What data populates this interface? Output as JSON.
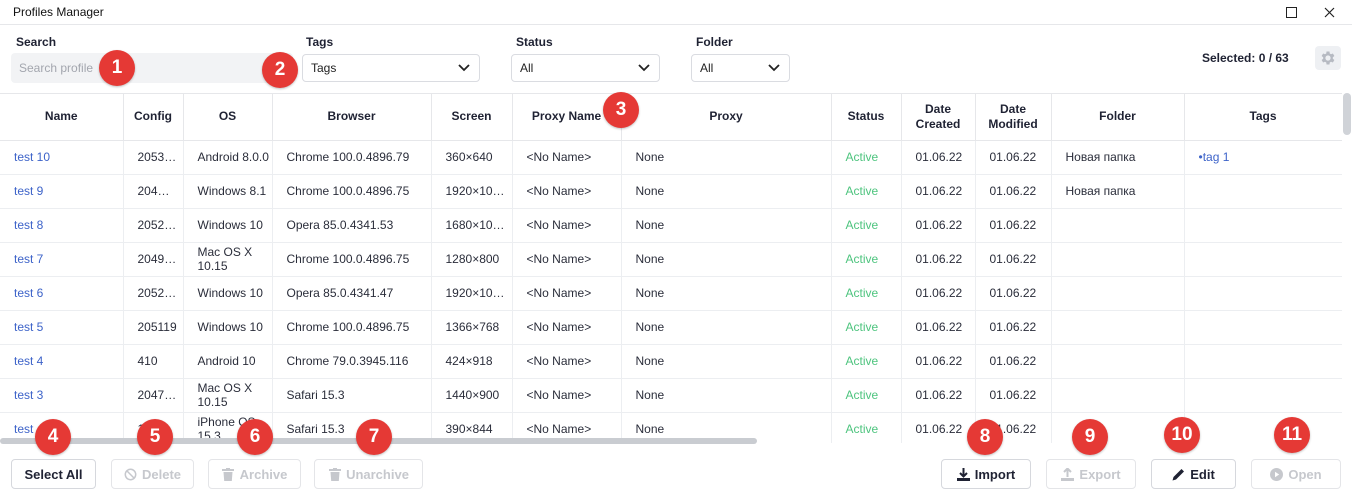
{
  "window": {
    "title": "Profiles Manager"
  },
  "filters": {
    "search_label": "Search",
    "search_placeholder": "Search profile",
    "tags_label": "Tags",
    "tags_value": "Tags",
    "status_label": "Status",
    "status_value": "All",
    "folder_label": "Folder",
    "folder_value": "All"
  },
  "selected_text": "Selected: 0 / 63",
  "columns": [
    "Name",
    "Config",
    "OS",
    "Browser",
    "Screen",
    "Proxy Name",
    "Proxy",
    "Status",
    "Date Created",
    "Date Modified",
    "Folder",
    "Tags"
  ],
  "rows": [
    {
      "name": "test 10",
      "config": "2053…",
      "os": "Android 8.0.0",
      "browser": "Chrome 100.0.4896.79",
      "screen": "360×640",
      "proxy_name": "<No Name>",
      "proxy": "None",
      "status": "Active",
      "created": "01.06.22",
      "modified": "01.06.22",
      "folder": "Новая папка",
      "tags": "•tag 1"
    },
    {
      "name": "test 9",
      "config": "204…",
      "os": "Windows 8.1",
      "browser": "Chrome 100.0.4896.75",
      "screen": "1920×10…",
      "proxy_name": "<No Name>",
      "proxy": "None",
      "status": "Active",
      "created": "01.06.22",
      "modified": "01.06.22",
      "folder": "Новая папка",
      "tags": ""
    },
    {
      "name": "test 8",
      "config": "2052…",
      "os": "Windows 10",
      "browser": "Opera 85.0.4341.53",
      "screen": "1680×10…",
      "proxy_name": "<No Name>",
      "proxy": "None",
      "status": "Active",
      "created": "01.06.22",
      "modified": "01.06.22",
      "folder": "",
      "tags": ""
    },
    {
      "name": "test 7",
      "config": "2049…",
      "os": "Mac OS X 10.15",
      "browser": "Chrome 100.0.4896.75",
      "screen": "1280×800",
      "proxy_name": "<No Name>",
      "proxy": "None",
      "status": "Active",
      "created": "01.06.22",
      "modified": "01.06.22",
      "folder": "",
      "tags": ""
    },
    {
      "name": "test 6",
      "config": "2052…",
      "os": "Windows 10",
      "browser": "Opera 85.0.4341.47",
      "screen": "1920×10…",
      "proxy_name": "<No Name>",
      "proxy": "None",
      "status": "Active",
      "created": "01.06.22",
      "modified": "01.06.22",
      "folder": "",
      "tags": ""
    },
    {
      "name": "test 5",
      "config": "205119",
      "os": "Windows 10",
      "browser": "Chrome 100.0.4896.75",
      "screen": "1366×768",
      "proxy_name": "<No Name>",
      "proxy": "None",
      "status": "Active",
      "created": "01.06.22",
      "modified": "01.06.22",
      "folder": "",
      "tags": ""
    },
    {
      "name": "test 4",
      "config": "410",
      "os": "Android 10",
      "browser": "Chrome 79.0.3945.116",
      "screen": "424×918",
      "proxy_name": "<No Name>",
      "proxy": "None",
      "status": "Active",
      "created": "01.06.22",
      "modified": "01.06.22",
      "folder": "",
      "tags": ""
    },
    {
      "name": "test 3",
      "config": "2047…",
      "os": "Mac OS X 10.15",
      "browser": "Safari 15.3",
      "screen": "1440×900",
      "proxy_name": "<No Name>",
      "proxy": "None",
      "status": "Active",
      "created": "01.06.22",
      "modified": "01.06.22",
      "folder": "",
      "tags": ""
    },
    {
      "name": "test",
      "config": "1…6",
      "os": "iPhone OS 15.3",
      "browser": "Safari 15.3",
      "screen": "390×844",
      "proxy_name": "<No Name>",
      "proxy": "None",
      "status": "Active",
      "created": "01.06.22",
      "modified": "01.06.22",
      "folder": "",
      "tags": ""
    }
  ],
  "buttons": {
    "select_all": "Select All",
    "delete": "Delete",
    "archive": "Archive",
    "unarchive": "Unarchive",
    "import": "Import",
    "export": "Export",
    "edit": "Edit",
    "open": "Open"
  },
  "badges": [
    "1",
    "2",
    "3",
    "4",
    "5",
    "6",
    "7",
    "8",
    "9",
    "10",
    "11"
  ],
  "colors": {
    "link": "#3d63c9",
    "status_active": "#4dc47e",
    "badge": "#e53935"
  },
  "icons": [
    "square-icon",
    "close-icon",
    "chevron-down-icon",
    "gear-icon",
    "ban-icon",
    "trash-icon",
    "download-icon",
    "upload-icon",
    "pencil-icon",
    "play-icon"
  ]
}
